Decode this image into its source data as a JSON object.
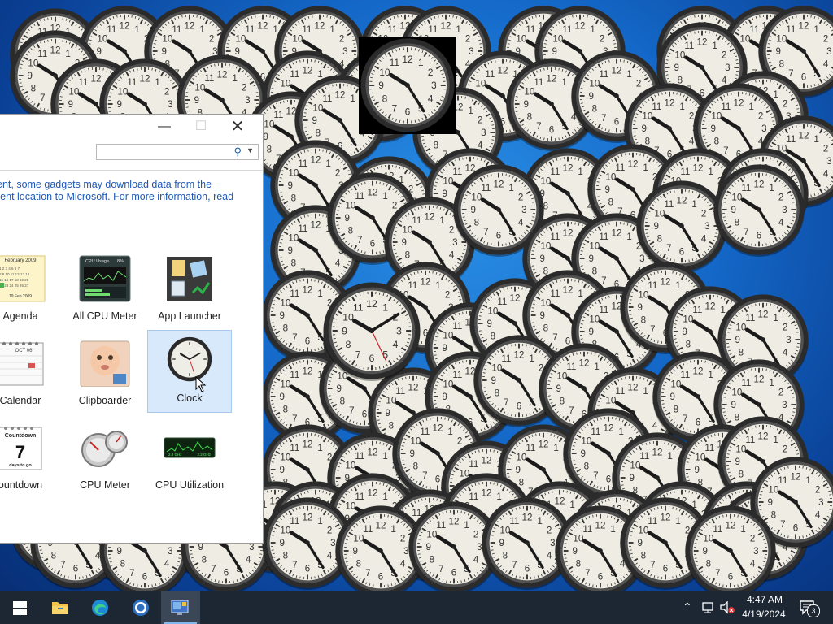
{
  "gallery": {
    "search": {
      "placeholder": "",
      "value": ""
    },
    "notice_line1": "ent, some gadgets may download data from the",
    "notice_line2": "rent location to Microsoft. For more information, read",
    "gadgets": [
      {
        "label": "Agenda",
        "icon": "agenda-calendar-icon",
        "selected": false
      },
      {
        "label": "All CPU Meter",
        "icon": "cpu-meter-graph-icon",
        "selected": false
      },
      {
        "label": "App Launcher",
        "icon": "app-launcher-icon",
        "selected": false
      },
      {
        "label": "Calendar",
        "icon": "calendar-icon",
        "selected": false
      },
      {
        "label": "Clipboarder",
        "icon": "clipboarder-baby-icon",
        "selected": false
      },
      {
        "label": "Clock",
        "icon": "clock-icon",
        "selected": true
      },
      {
        "label": "ountdown",
        "icon": "countdown-icon",
        "selected": false
      },
      {
        "label": "CPU Meter",
        "icon": "cpu-gauge-icon",
        "selected": false
      },
      {
        "label": "CPU Utilization",
        "icon": "cpu-utilization-icon",
        "selected": false
      }
    ],
    "thumb_text": {
      "agenda_month": "February 2009",
      "agenda_footer": "19 Feb 2009",
      "cpu_title": "CPU Usage",
      "cpu_pct": "8%",
      "calendar_month": "OCT 06",
      "countdown_title": "Countdown",
      "countdown_number": "7",
      "countdown_sub": "days to go",
      "cpu_util_readout": "2.2 GHz"
    }
  },
  "desktop": {
    "clock_face_numbers": [
      "12",
      "1",
      "2",
      "3",
      "4",
      "5",
      "6",
      "7",
      "8",
      "9",
      "10",
      "11"
    ],
    "clock_count_note": ""
  },
  "taskbar": {
    "icons": [
      "windows-start-icon",
      "file-explorer-icon",
      "edge-icon",
      "chrome-icon",
      "gadgets-app-icon"
    ],
    "time": "4:47 AM",
    "date": "4/19/2024",
    "notification_count": "3"
  },
  "colors": {
    "accent": "#1f59b6",
    "selected_bg": "#d8e9fb",
    "taskbar": "#1c2733"
  }
}
